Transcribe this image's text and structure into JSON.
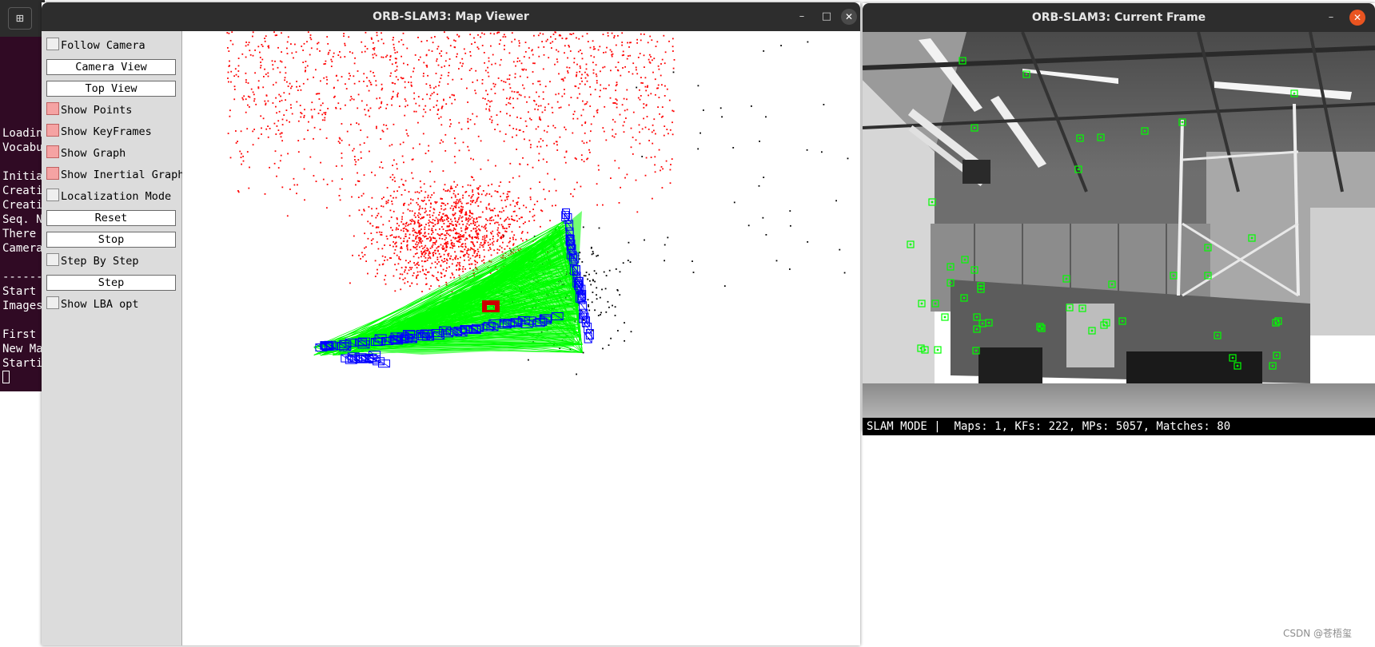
{
  "terminal": {
    "lines": [
      "Loadin",
      "Vocabu",
      "",
      "Initia",
      "Creati",
      "Creati",
      "Seq. N",
      "There",
      "Camera",
      "",
      "------",
      "Start",
      "Images",
      "",
      "First",
      "New Ma",
      "Starti"
    ]
  },
  "map_viewer": {
    "title": "ORB-SLAM3: Map Viewer",
    "controls": {
      "minimize": "–",
      "maximize": "□",
      "close": "✕"
    },
    "panel": {
      "follow_camera": {
        "label": "Follow Camera",
        "checked": false
      },
      "camera_view": "Camera View",
      "top_view": "Top View",
      "show_points": {
        "label": "Show Points",
        "checked": true
      },
      "show_keyframes": {
        "label": "Show KeyFrames",
        "checked": true
      },
      "show_graph": {
        "label": "Show Graph",
        "checked": true
      },
      "show_inertial_graph": {
        "label": "Show Inertial Graph",
        "checked": true
      },
      "localization_mode": {
        "label": "Localization Mode",
        "checked": false
      },
      "reset": "Reset",
      "stop": "Stop",
      "step_by_step": {
        "label": "Step By Step",
        "checked": false
      },
      "step": "Step",
      "show_lba_opt": {
        "label": "Show LBA opt",
        "checked": false
      }
    },
    "colors": {
      "map_points": "#ff0000",
      "reference_points": "#000000",
      "keyframes": "#0000ff",
      "covisibility_graph": "#00ff00",
      "current_camera": "#cc0000"
    }
  },
  "current_frame": {
    "title": "ORB-SLAM3: Current Frame",
    "controls": {
      "minimize": "–",
      "close": "✕"
    },
    "status_bar": "SLAM MODE |  Maps: 1, KFs: 222, MPs: 5057, Matches: 80",
    "colors": {
      "feature_markers": "#00ff00"
    }
  },
  "watermark": "CSDN @苍梧玺"
}
